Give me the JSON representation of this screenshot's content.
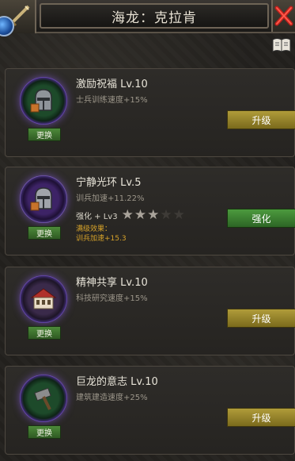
{
  "header": {
    "title": "海龙：克拉肯",
    "back_icon": "sword-back-icon",
    "close_icon": "close-x-icon",
    "book_icon": "book-icon"
  },
  "skills": [
    {
      "name": "激励祝福 Lv.10",
      "desc": "士兵训练速度+15%",
      "icon": "knight-helmet-icon",
      "change_label": "更换",
      "action_label": "升级",
      "action_color": "#9a8730"
    },
    {
      "name": "宁静光环 Lv.5",
      "desc": "训兵加速+11.22%",
      "icon": "knight-helmet-icon",
      "change_label": "更换",
      "enhance_label": "强化 + Lv3",
      "stars_filled": 3,
      "stars_total": 5,
      "max_effect_label": "满级效果：",
      "max_effect_value": "训兵加速+15.3",
      "action_label": "强化",
      "action_color": "#3f8a33"
    },
    {
      "name": "精神共享 Lv.10",
      "desc": "科技研究速度+15%",
      "icon": "academy-building-icon",
      "change_label": "更换",
      "action_label": "升级",
      "action_color": "#9a8730"
    },
    {
      "name": "巨龙的意志 Lv.10",
      "desc": "建筑建造速度+25%",
      "icon": "hammer-icon",
      "change_label": "更换",
      "action_label": "升级",
      "action_color": "#9a8730"
    }
  ]
}
